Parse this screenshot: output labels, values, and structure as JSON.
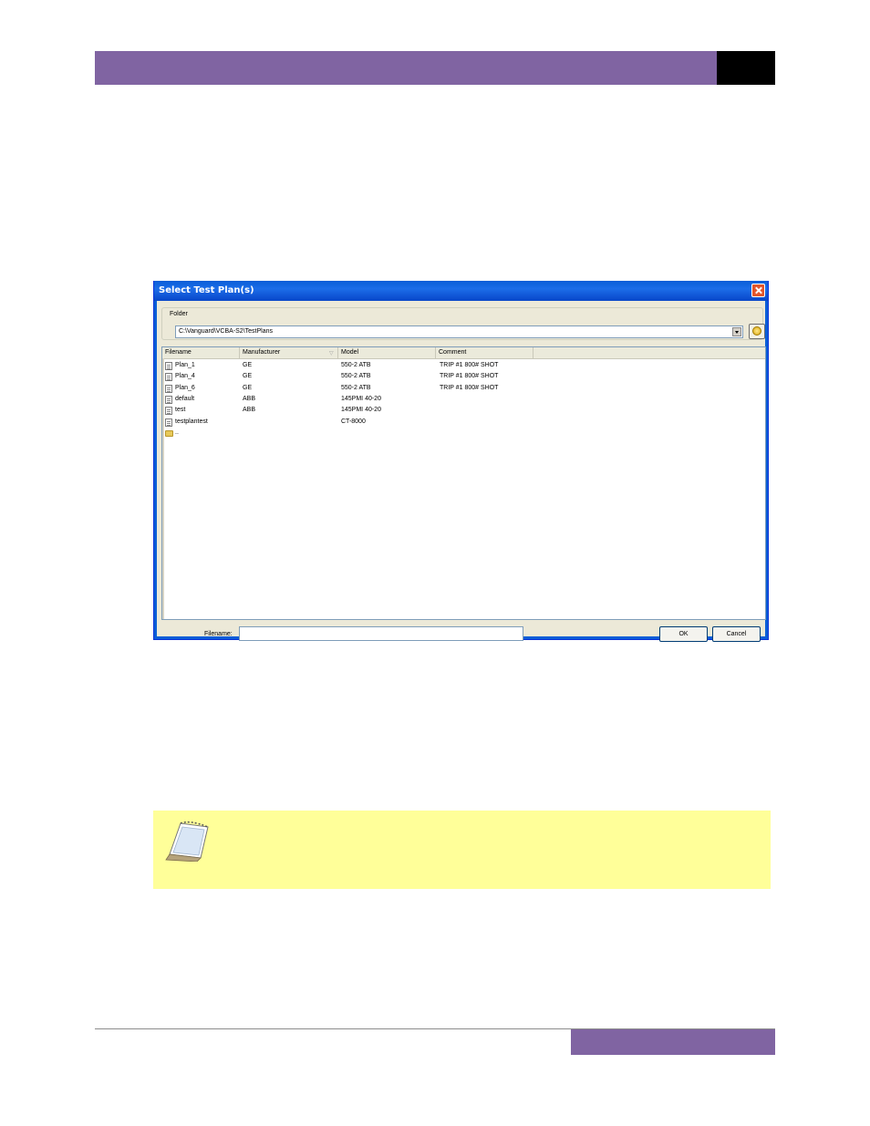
{
  "dialog": {
    "title": "Select Test Plan(s)",
    "folder_label": "Folder",
    "folder_path": "C:\\Vanguard\\VCBA-S2\\TestPlans",
    "columns": [
      "Filename",
      "Manufacturer",
      "Model",
      "Comment"
    ],
    "rows": [
      {
        "filename": "Plan_1",
        "manufacturer": "GE",
        "model": "550-2 ATB",
        "comment": "TRIP #1 800# SHOT",
        "icon": "file-icon"
      },
      {
        "filename": "Plan_4",
        "manufacturer": "GE",
        "model": "550-2 ATB",
        "comment": "TRIP #1 800# SHOT",
        "icon": "file-icon"
      },
      {
        "filename": "Plan_6",
        "manufacturer": "GE",
        "model": "550-2 ATB",
        "comment": "TRIP #1 800# SHOT",
        "icon": "file-icon"
      },
      {
        "filename": "default",
        "manufacturer": "ABB",
        "model": "145PMI 40-20",
        "comment": "",
        "icon": "file-icon"
      },
      {
        "filename": "test",
        "manufacturer": "ABB",
        "model": "145PMI 40-20",
        "comment": "",
        "icon": "file-icon"
      },
      {
        "filename": "testplantest",
        "manufacturer": "",
        "model": "CT-8000",
        "comment": "",
        "icon": "file-icon"
      },
      {
        "filename": "..",
        "manufacturer": "",
        "model": "",
        "comment": "",
        "icon": "folder-up-icon"
      }
    ],
    "filename_label": "Filename:",
    "filename_value": "",
    "ok_label": "OK",
    "cancel_label": "Cancel"
  },
  "colors": {
    "header_bar": "#8064a2",
    "titlebar": "#0a5ed7",
    "note_background": "#ffff99"
  }
}
